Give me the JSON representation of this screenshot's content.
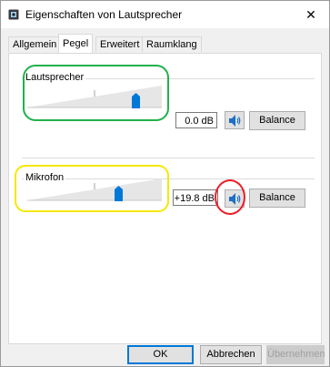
{
  "window": {
    "title": "Eigenschaften von Lautsprecher",
    "close_glyph": "✕"
  },
  "tabs": [
    {
      "label": "Allgemein",
      "active": false
    },
    {
      "label": "Pegel",
      "active": true
    },
    {
      "label": "Erweitert",
      "active": false
    },
    {
      "label": "Raumklang",
      "active": false
    }
  ],
  "channels": {
    "speaker": {
      "label": "Lautsprecher",
      "value_text": "0.0 dB",
      "slider_level": 0.83,
      "balance_label": "Balance",
      "mute_icon": "speaker-icon"
    },
    "microphone": {
      "label": "Mikrofon",
      "value_text": "+19.8 dB",
      "slider_level": 0.69,
      "balance_label": "Balance",
      "mute_icon": "speaker-icon"
    }
  },
  "footer": {
    "ok_label": "OK",
    "cancel_label": "Abbrechen",
    "apply_label": "Übernehmen"
  },
  "colors": {
    "accent": "#0078d7",
    "annotation_green": "#22b14c",
    "annotation_yellow": "#f5e800",
    "annotation_red": "#ed1c24"
  }
}
